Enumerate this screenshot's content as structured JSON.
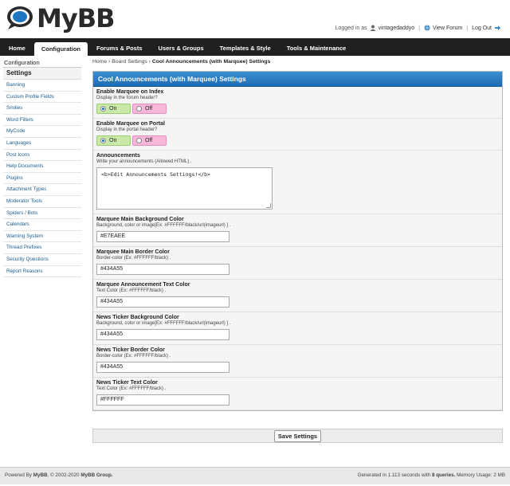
{
  "header": {
    "logo_text": "MyBB",
    "logged_in_as": "Logged in as",
    "username": "vintagedaddyo",
    "view_forum": "View Forum",
    "log_out": "Log Out"
  },
  "nav": {
    "tabs": [
      {
        "label": "Home"
      },
      {
        "label": "Configuration"
      },
      {
        "label": "Forums & Posts"
      },
      {
        "label": "Users & Groups"
      },
      {
        "label": "Templates & Style"
      },
      {
        "label": "Tools & Maintenance"
      }
    ]
  },
  "sidebar": {
    "heading": "Configuration",
    "section": "Settings",
    "items": [
      {
        "label": "Banning"
      },
      {
        "label": "Custom Profile Fields"
      },
      {
        "label": "Smilies"
      },
      {
        "label": "Word Filters"
      },
      {
        "label": "MyCode"
      },
      {
        "label": "Languages"
      },
      {
        "label": "Post Icons"
      },
      {
        "label": "Help Documents"
      },
      {
        "label": "Plugins"
      },
      {
        "label": "Attachment Types"
      },
      {
        "label": "Moderator Tools"
      },
      {
        "label": "Spiders / Bots"
      },
      {
        "label": "Calendars"
      },
      {
        "label": "Warning System"
      },
      {
        "label": "Thread Prefixes"
      },
      {
        "label": "Security Questions"
      },
      {
        "label": "Report Reasons"
      }
    ]
  },
  "breadcrumb": {
    "home": "Home",
    "sep": "›",
    "board_settings": "Board Settings",
    "current": "Cool Announcements (with Marquee) Settings"
  },
  "panel": {
    "title": "Cool Announcements (with Marquee) Settings",
    "settings": [
      {
        "title": "Enable Marquee on Index",
        "desc": "Display in the forum header?",
        "on_label": "On",
        "off_label": "Off"
      },
      {
        "title": "Enable Marquee on Portal",
        "desc": "Display in the portal header?",
        "on_label": "On",
        "off_label": "Off"
      },
      {
        "title": "Announcements",
        "desc": "Write your announcements (Allowed HTML) .",
        "value": "<b>Edit Announcements Settings!</b>"
      },
      {
        "title": "Marquee Main Background Color",
        "desc": "Background, color or image[Ex: #FFFFFF/black/url(imageurl) ] .",
        "value": "#E7EAEE"
      },
      {
        "title": "Marquee Main Border Color",
        "desc": "Border-color (Ex: #FFFFFF/black) .",
        "value": "#434A55"
      },
      {
        "title": "Marquee Announcement Text Color",
        "desc": "Text Color (Ex: #FFFFFF/black) .",
        "value": "#434A55"
      },
      {
        "title": "News Ticker Background Color",
        "desc": "Background, color or image[Ex: #FFFFFF/black/url(imageurl) ] .",
        "value": "#434A55"
      },
      {
        "title": "News Ticker Border Color",
        "desc": "Border-color (Ex: #FFFFFF/black) .",
        "value": "#434A55"
      },
      {
        "title": "News Ticker Text Color",
        "desc": "Text Color (Ex: #FFFFFF/black) .",
        "value": "#FFFFFF"
      }
    ]
  },
  "save_label": "Save Settings",
  "footer": {
    "powered_prefix": "Powered By",
    "powered_brand": "MyBB",
    "copyright": ", © 2002-2020",
    "group": "MyBB Group.",
    "gen_prefix": "Generated in 1.113 seconds with",
    "queries": "8 queries.",
    "memory": "Memory Usage: 2 MB"
  },
  "colors": {
    "nav_bg": "#202020",
    "panel_head": "#1e6bb3",
    "on_bg": "#c9e9a8",
    "off_bg": "#f6b7d9",
    "link": "#1a5c8f"
  }
}
